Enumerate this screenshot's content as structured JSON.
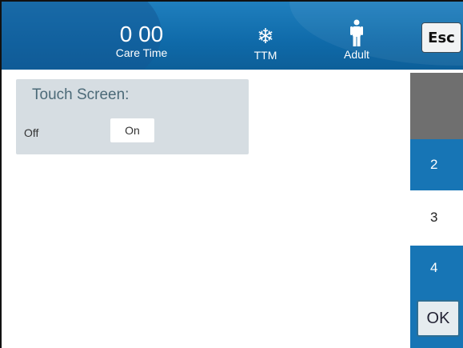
{
  "header": {
    "care_time_value": "0 00",
    "care_time_label": "Care Time",
    "ttm_label": "TTM",
    "ttm_icon": "snowflake-icon",
    "patient_label": "Adult",
    "patient_icon": "adult-person-icon",
    "esc_label": "Esc"
  },
  "panel": {
    "title": "Touch Screen:",
    "options": [
      "Off",
      "On"
    ],
    "selected": "On"
  },
  "selector": {
    "items": [
      "2",
      "3",
      "4"
    ],
    "selected": "3",
    "ok_label": "OK"
  },
  "colors": {
    "header_blue": "#1f7fbe",
    "selector_blue": "#1775b5",
    "panel_gray": "#d6dde2"
  }
}
